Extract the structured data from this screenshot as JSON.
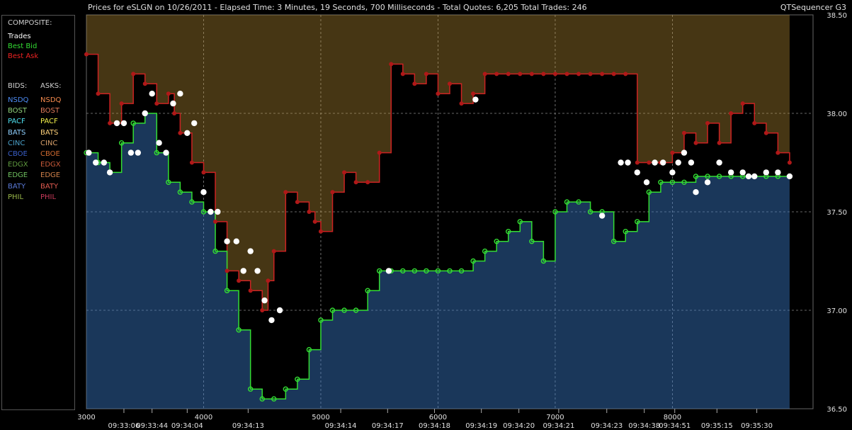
{
  "title": "Prices for  eSLGN  on  10/26/2011  -  Elapsed Time: 3 Minutes, 19 Seconds, 700 Milliseconds  -  Total Quotes: 6,205  Total Trades: 246",
  "app_name": "QTSequencer G3",
  "legend": {
    "composite_header": "COMPOSITE:",
    "composite": [
      {
        "label": "Trades",
        "color": "#ffffff"
      },
      {
        "label": "Best Bid",
        "color": "#33dd33"
      },
      {
        "label": "Best Ask",
        "color": "#ee2222"
      }
    ],
    "bids_header": "BIDS:",
    "asks_header": "ASKS:",
    "exchanges": [
      {
        "bid": "NSDQ",
        "ask": "NSDQ",
        "bid_color": "#4d8cf5",
        "ask_color": "#f58a4d"
      },
      {
        "bid": "BOST",
        "ask": "BOST",
        "bid_color": "#8fd17a",
        "ask_color": "#e07a5a"
      },
      {
        "bid": "PACF",
        "ask": "PACF",
        "bid_color": "#4fe0f0",
        "ask_color": "#f4f04a"
      },
      {
        "bid": "BATS",
        "ask": "BATS",
        "bid_color": "#8fd0ff",
        "ask_color": "#ffd27a"
      },
      {
        "bid": "CINC",
        "ask": "CINC",
        "bid_color": "#4aa0c8",
        "ask_color": "#d8a06a"
      },
      {
        "bid": "CBOE",
        "ask": "CBOE",
        "bid_color": "#3a5fc8",
        "ask_color": "#d06a30"
      },
      {
        "bid": "EDGX",
        "ask": "EDGX",
        "bid_color": "#5f9a3f",
        "ask_color": "#c85a3a"
      },
      {
        "bid": "EDGE",
        "ask": "EDGE",
        "bid_color": "#6fbf5f",
        "ask_color": "#d0804a"
      },
      {
        "bid": "BATY",
        "ask": "BATY",
        "bid_color": "#5a7ad8",
        "ask_color": "#e05a50"
      },
      {
        "bid": "PHIL",
        "ask": "PHIL",
        "bid_color": "#9ab84a",
        "ask_color": "#c83a5a"
      }
    ]
  },
  "chart_data": {
    "type": "line",
    "x_label": "",
    "y_label": "",
    "xlim": [
      3000,
      9200
    ],
    "ylim": [
      36.5,
      38.5
    ],
    "y_ticks": [
      36.5,
      37.0,
      37.5,
      38.0,
      38.5
    ],
    "y_tick_labels": [
      "36.50",
      "37.00",
      "37.50",
      "38.00",
      "38.50"
    ],
    "x_ticks": [
      3000,
      4000,
      5000,
      6000,
      7000,
      8000
    ],
    "x_tick_labels": [
      "3000",
      "4000",
      "5000",
      "6000",
      "7000",
      "8000"
    ],
    "time_labels": [
      {
        "x": 3320,
        "label": "09:33:06"
      },
      {
        "x": 3560,
        "label": "09:33:44"
      },
      {
        "x": 3860,
        "label": "09:34:04"
      },
      {
        "x": 4380,
        "label": "09:34:13"
      },
      {
        "x": 5170,
        "label": "09:34:14"
      },
      {
        "x": 5570,
        "label": "09:34:17"
      },
      {
        "x": 5970,
        "label": "09:34:18"
      },
      {
        "x": 6370,
        "label": "09:34:19"
      },
      {
        "x": 6690,
        "label": "09:34:20"
      },
      {
        "x": 7030,
        "label": "09:34:21"
      },
      {
        "x": 7440,
        "label": "09:34:23"
      },
      {
        "x": 7760,
        "label": "09:34:38"
      },
      {
        "x": 8020,
        "label": "09:34:51"
      },
      {
        "x": 8380,
        "label": "09:35:15"
      },
      {
        "x": 8720,
        "label": "09:35:30"
      }
    ],
    "grid": true,
    "series": [
      {
        "name": "Best Ask",
        "color": "#cc2222",
        "x": [
          3000,
          3100,
          3200,
          3300,
          3400,
          3500,
          3600,
          3700,
          3750,
          3800,
          3900,
          4000,
          4100,
          4200,
          4300,
          4400,
          4500,
          4550,
          4600,
          4700,
          4800,
          4900,
          4950,
          5000,
          5100,
          5200,
          5300,
          5400,
          5500,
          5600,
          5700,
          5800,
          5900,
          6000,
          6100,
          6200,
          6300,
          6400,
          6500,
          6600,
          6700,
          6800,
          6900,
          7000,
          7100,
          7200,
          7300,
          7400,
          7500,
          7600,
          7700,
          7800,
          7900,
          8000,
          8100,
          8200,
          8300,
          8400,
          8500,
          8600,
          8700,
          8800,
          8900,
          9000
        ],
        "values": [
          38.3,
          38.1,
          37.95,
          38.05,
          38.2,
          38.15,
          38.05,
          38.1,
          38.0,
          37.9,
          37.75,
          37.7,
          37.45,
          37.2,
          37.15,
          37.1,
          37.0,
          37.15,
          37.3,
          37.6,
          37.55,
          37.5,
          37.45,
          37.4,
          37.6,
          37.7,
          37.65,
          37.65,
          37.8,
          38.25,
          38.2,
          38.15,
          38.2,
          38.1,
          38.15,
          38.05,
          38.1,
          38.2,
          38.2,
          38.2,
          38.2,
          38.2,
          38.2,
          38.2,
          38.2,
          38.2,
          38.2,
          38.2,
          38.2,
          38.2,
          37.75,
          37.75,
          37.75,
          37.8,
          37.9,
          37.85,
          37.95,
          37.85,
          38.0,
          38.05,
          37.95,
          37.9,
          37.8,
          37.75
        ]
      },
      {
        "name": "Best Bid",
        "color": "#33dd33",
        "x": [
          3000,
          3100,
          3200,
          3300,
          3400,
          3500,
          3600,
          3700,
          3800,
          3900,
          4000,
          4100,
          4200,
          4300,
          4400,
          4500,
          4600,
          4700,
          4800,
          4900,
          5000,
          5100,
          5200,
          5300,
          5400,
          5500,
          5600,
          5700,
          5800,
          5900,
          6000,
          6100,
          6200,
          6300,
          6400,
          6500,
          6600,
          6700,
          6800,
          6900,
          7000,
          7100,
          7200,
          7300,
          7400,
          7500,
          7600,
          7700,
          7800,
          7900,
          8000,
          8100,
          8200,
          8300,
          8400,
          8500,
          8600,
          8700,
          8800,
          8900,
          9000
        ],
        "values": [
          37.8,
          37.75,
          37.7,
          37.85,
          37.95,
          38.0,
          37.8,
          37.65,
          37.6,
          37.55,
          37.5,
          37.3,
          37.1,
          36.9,
          36.6,
          36.55,
          36.55,
          36.6,
          36.65,
          36.8,
          36.95,
          37.0,
          37.0,
          37.0,
          37.1,
          37.2,
          37.2,
          37.2,
          37.2,
          37.2,
          37.2,
          37.2,
          37.2,
          37.25,
          37.3,
          37.35,
          37.4,
          37.45,
          37.35,
          37.25,
          37.5,
          37.55,
          37.55,
          37.5,
          37.5,
          37.35,
          37.4,
          37.45,
          37.6,
          37.65,
          37.65,
          37.65,
          37.68,
          37.68,
          37.68,
          37.68,
          37.68,
          37.68,
          37.68,
          37.68,
          37.68
        ]
      },
      {
        "name": "Trades",
        "color": "#ffffff",
        "x": [
          3020,
          3080,
          3150,
          3200,
          3260,
          3320,
          3380,
          3440,
          3500,
          3560,
          3620,
          3680,
          3740,
          3800,
          3860,
          3920,
          4000,
          4060,
          4120,
          4200,
          4280,
          4340,
          4400,
          4460,
          4520,
          4580,
          4650,
          5580,
          6320,
          7400,
          7560,
          7620,
          7700,
          7780,
          7850,
          7920,
          8000,
          8050,
          8100,
          8160,
          8200,
          8300,
          8400,
          8500,
          8600,
          8650,
          8700,
          8800,
          8900,
          9000
        ],
        "values": [
          37.8,
          37.75,
          37.75,
          37.7,
          37.95,
          37.95,
          37.8,
          37.8,
          38.0,
          38.1,
          37.85,
          37.8,
          38.05,
          38.1,
          37.9,
          37.95,
          37.6,
          37.5,
          37.5,
          37.35,
          37.35,
          37.2,
          37.3,
          37.2,
          37.05,
          36.95,
          37.0,
          37.2,
          38.07,
          37.48,
          37.75,
          37.75,
          37.7,
          37.65,
          37.75,
          37.75,
          37.7,
          37.75,
          37.8,
          37.75,
          37.6,
          37.65,
          37.75,
          37.7,
          37.7,
          37.68,
          37.68,
          37.7,
          37.7,
          37.68
        ]
      }
    ]
  }
}
